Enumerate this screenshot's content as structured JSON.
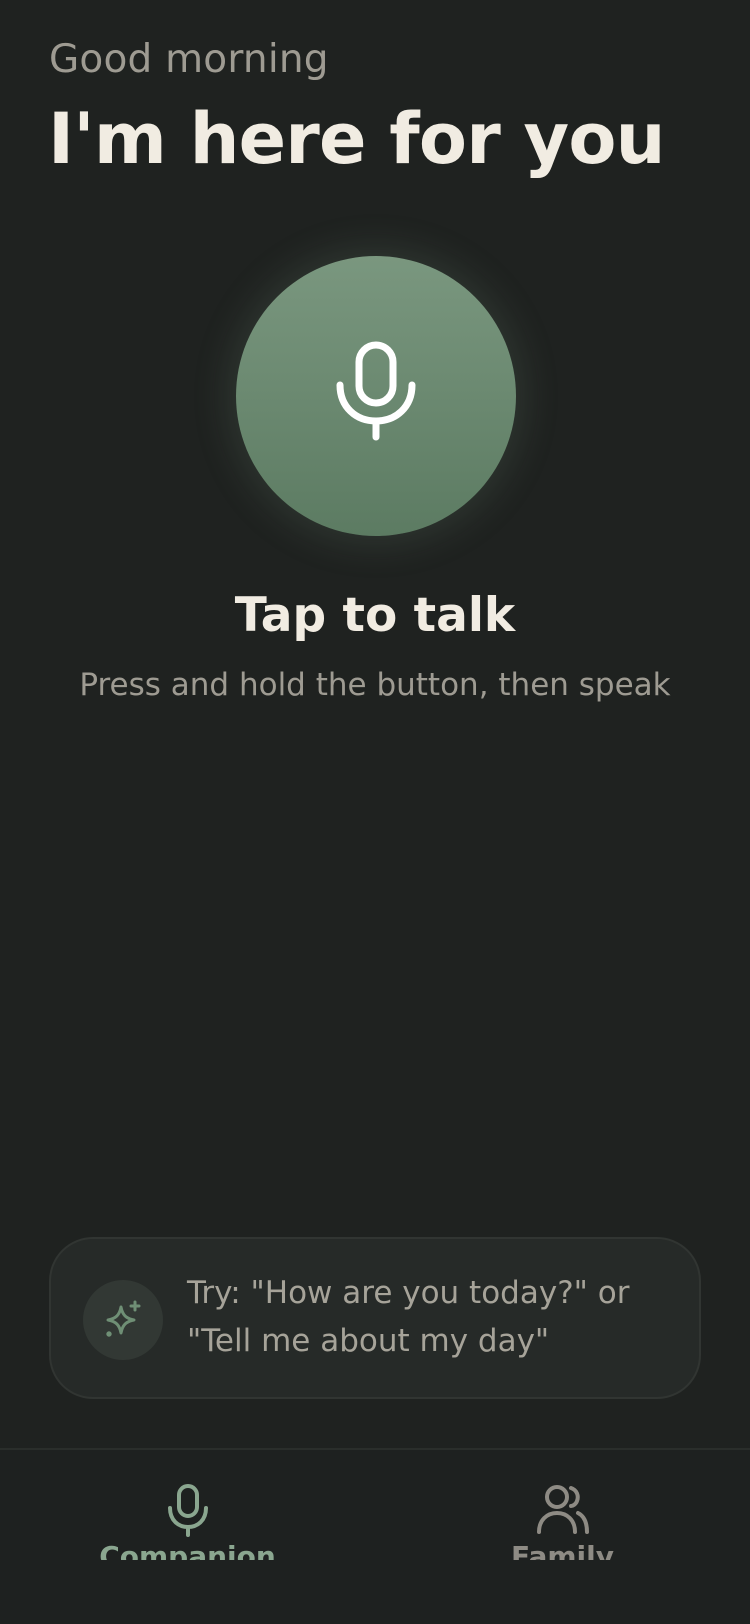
{
  "header": {
    "greeting": "Good morning",
    "headline": "I'm here for you"
  },
  "voice": {
    "button_icon": "microphone-icon",
    "title": "Tap to talk",
    "subtitle": "Press and hold the button, then speak"
  },
  "hint": {
    "icon": "sparkle-icon",
    "line1": "Try: \"How are you today?\" or",
    "line2": "\"Tell me about my day\""
  },
  "tabs": [
    {
      "label": "Companion",
      "icon": "microphone-icon",
      "active": true
    },
    {
      "label": "Family",
      "icon": "people-icon",
      "active": false
    }
  ],
  "colors": {
    "background": "#1f2220",
    "accent": "#7a977f",
    "active_tab": "#8aa68f",
    "inactive_tab": "#8e8b84",
    "primary_text": "#f1ece2",
    "secondary_text": "#9e9b92"
  }
}
